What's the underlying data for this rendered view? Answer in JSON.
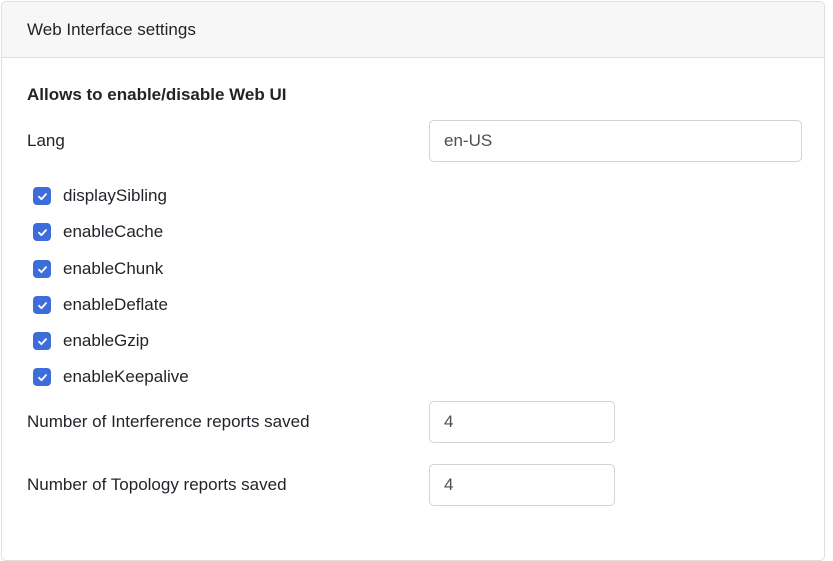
{
  "header": {
    "title": "Web Interface settings"
  },
  "section": {
    "title": "Allows to enable/disable Web UI"
  },
  "lang": {
    "label": "Lang",
    "value": "en-US"
  },
  "checkboxes": [
    {
      "label": "displaySibling",
      "checked": true
    },
    {
      "label": "enableCache",
      "checked": true
    },
    {
      "label": "enableChunk",
      "checked": true
    },
    {
      "label": "enableDeflate",
      "checked": true
    },
    {
      "label": "enableGzip",
      "checked": true
    },
    {
      "label": "enableKeepalive",
      "checked": true
    }
  ],
  "interference_reports": {
    "label": "Number of Interference reports saved",
    "value": "4"
  },
  "topology_reports": {
    "label": "Number of Topology reports saved",
    "value": "4"
  },
  "colors": {
    "checkbox_accent": "#3d6ddb",
    "header_bg": "#f7f7f7",
    "border": "#dfdfdf"
  }
}
